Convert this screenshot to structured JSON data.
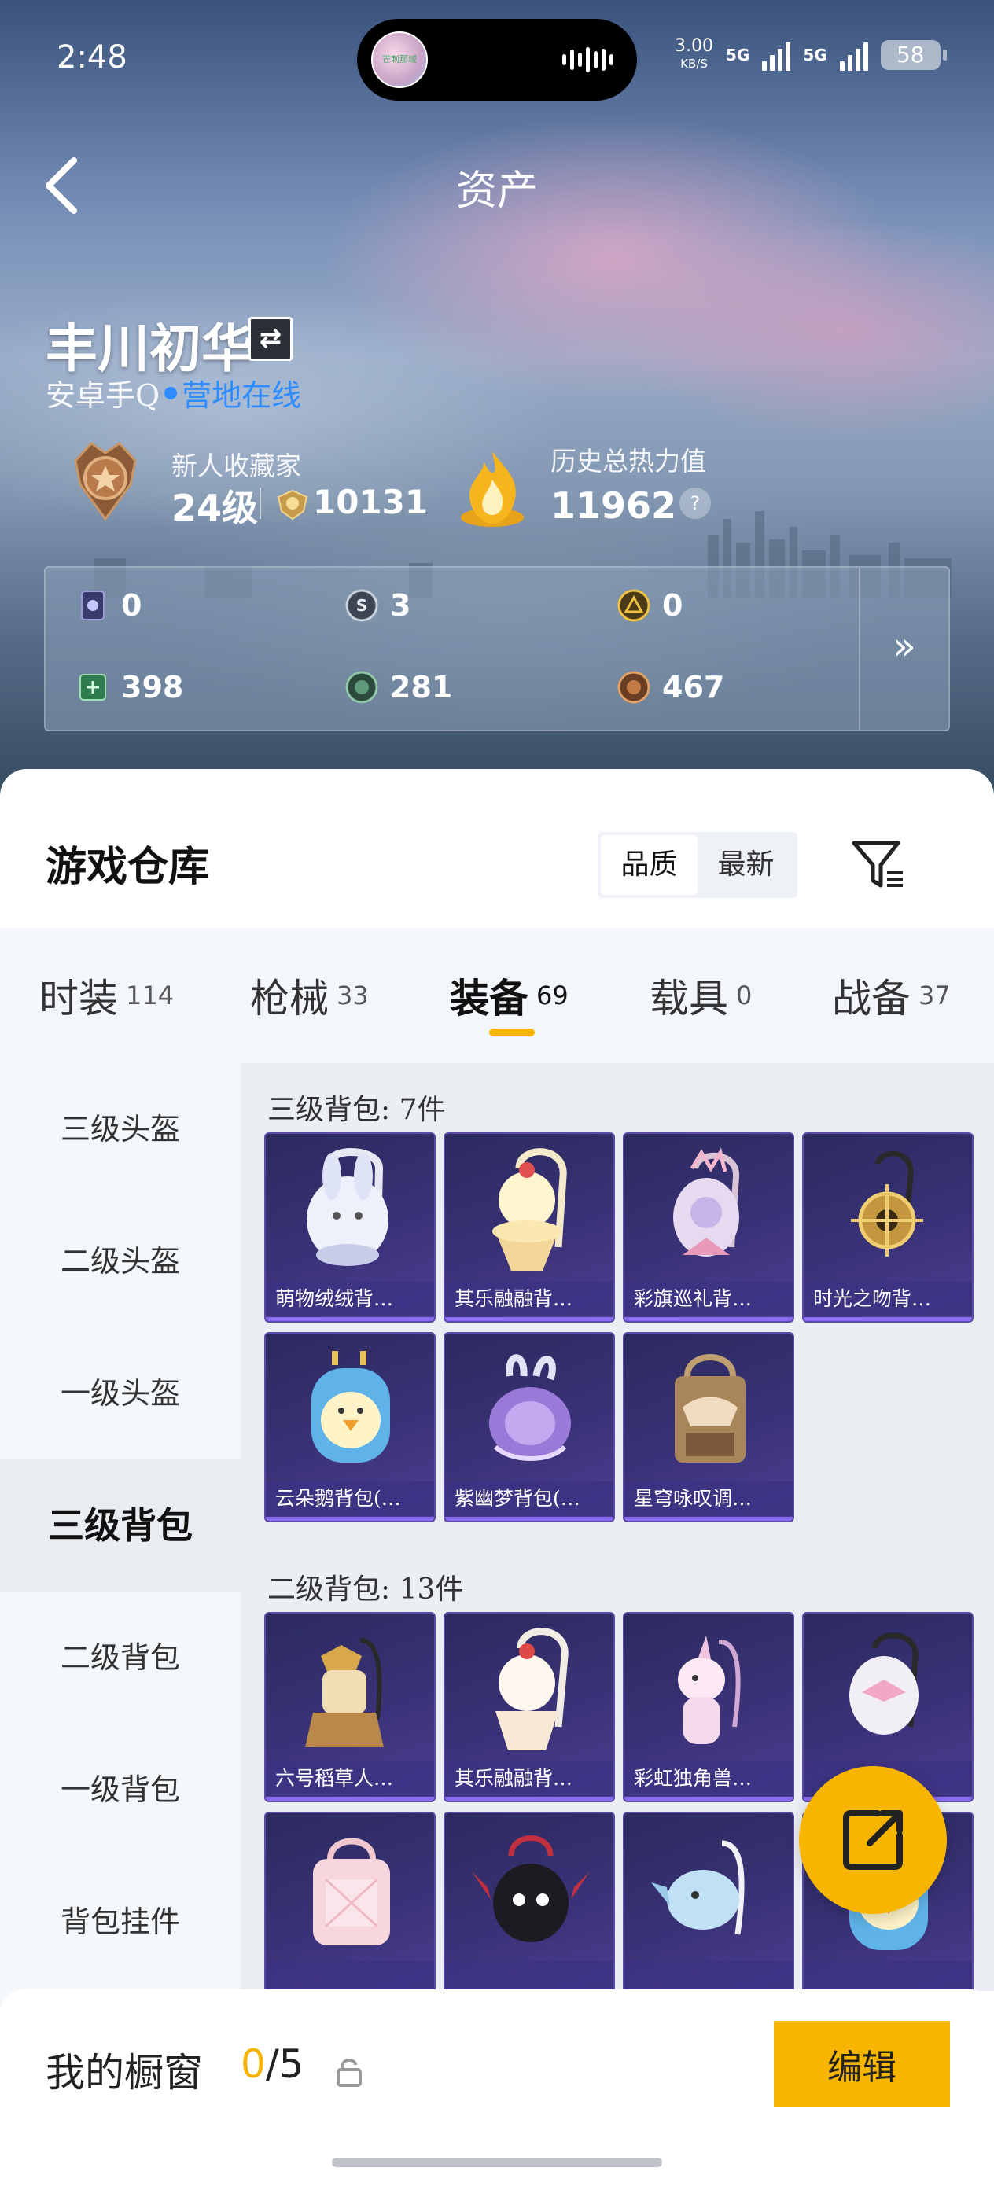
{
  "status_bar": {
    "time": "2:48",
    "island_avatar_text": "芒刺那域",
    "speed_value": "3.00",
    "speed_unit": "KB/S",
    "net1": "5G",
    "net2": "5G",
    "battery": "58"
  },
  "nav": {
    "title": "资产"
  },
  "user": {
    "name": "丰川初华",
    "platform": "安卓手Q",
    "online_status": "营地在线"
  },
  "collector": {
    "title": "新人收藏家",
    "level": "24级",
    "points": "10131"
  },
  "heat": {
    "title": "历史总热力值",
    "value": "11962",
    "help": "?"
  },
  "currencies": [
    {
      "icon": "purple-card-icon",
      "value": "0"
    },
    {
      "icon": "silver-coin-icon",
      "value": "3"
    },
    {
      "icon": "gold-coin-icon",
      "value": "0"
    },
    {
      "icon": "green-ticket-icon",
      "value": "398"
    },
    {
      "icon": "green-coin-icon",
      "value": "281"
    },
    {
      "icon": "bronze-coin-icon",
      "value": "467"
    }
  ],
  "currency_more": "»",
  "warehouse": {
    "title": "游戏仓库",
    "sort_options": [
      "品质",
      "最新"
    ],
    "sort_selected": "品质"
  },
  "categories": [
    {
      "label": "时装",
      "count": "114"
    },
    {
      "label": "枪械",
      "count": "33"
    },
    {
      "label": "装备",
      "count": "69",
      "active": true
    },
    {
      "label": "载具",
      "count": "0"
    },
    {
      "label": "战备",
      "count": "37"
    }
  ],
  "sidebar": [
    {
      "label": "三级头盔"
    },
    {
      "label": "二级头盔"
    },
    {
      "label": "一级头盔"
    },
    {
      "label": "三级背包",
      "active": true
    },
    {
      "label": "二级背包"
    },
    {
      "label": "一级背包"
    },
    {
      "label": "背包挂件"
    }
  ],
  "sections": [
    {
      "title": "三级背包: 7件",
      "items": [
        "萌物绒绒背…",
        "其乐融融背…",
        "彩旗巡礼背…",
        "时光之吻背…",
        "云朵鹅背包(…",
        "紫幽梦背包(…",
        "星穹咏叹调…"
      ]
    },
    {
      "title": "二级背包: 13件",
      "items": [
        "六号稻草人…",
        "其乐融融背…",
        "彩虹独角兽…",
        "",
        "",
        "",
        "",
        ""
      ]
    }
  ],
  "showcase": {
    "label": "我的橱窗",
    "count_current": "0",
    "count_total": "/5",
    "edit": "编辑"
  },
  "colors": {
    "accent": "#f7b500",
    "online": "#2f8cff",
    "card_bg": "#3a3278"
  }
}
